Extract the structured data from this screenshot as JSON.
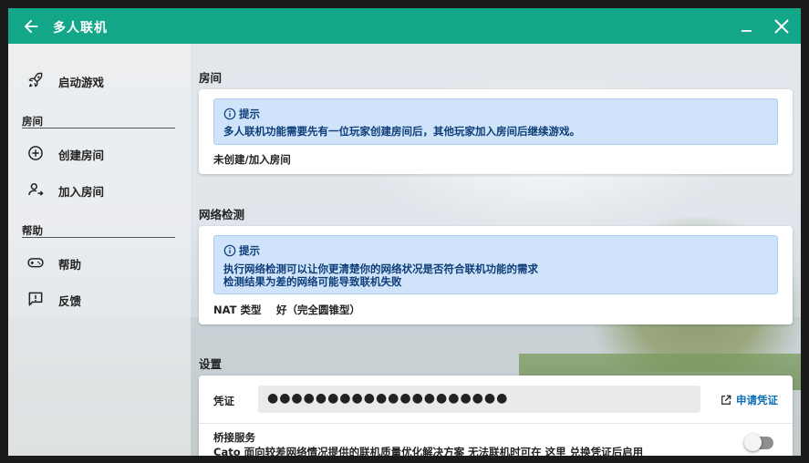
{
  "window": {
    "title": "多人联机"
  },
  "sidebar": {
    "top_item": {
      "label": "启动游戏",
      "icon": "rocket-icon"
    },
    "sections": [
      {
        "title": "房间",
        "items": [
          {
            "label": "创建房间",
            "icon": "add-circle-icon"
          },
          {
            "label": "加入房间",
            "icon": "join-user-icon"
          }
        ]
      },
      {
        "title": "帮助",
        "items": [
          {
            "label": "帮助",
            "icon": "gamepad-icon"
          },
          {
            "label": "反馈",
            "icon": "feedback-icon"
          }
        ]
      }
    ]
  },
  "room": {
    "title": "房间",
    "hint_title": "提示",
    "hint_text": "多人联机功能需要先有一位玩家创建房间后，其他玩家加入房间后继续游戏。",
    "status": "未创建/加入房间"
  },
  "network": {
    "title": "网络检测",
    "hint_title": "提示",
    "hint_line1": "执行网络检测可以让你更清楚你的网络状况是否符合联机功能的需求",
    "hint_line2": "检测结果为差的网络可能导致联机失败",
    "nat_label": "NAT 类型",
    "nat_value": "好（完全圆锥型）"
  },
  "settings": {
    "title": "设置",
    "credential_label": "凭证",
    "credential_value": "●●●●●●●●●●●●●●●●●●●●",
    "apply_label": "申请凭证",
    "bridge_title": "桥接服务",
    "bridge_desc": "Cato 面向较差网络情况提供的联机质量优化解决方案  无法联机时可在 这里 兑换凭证后启用",
    "bridge_enabled": false
  },
  "colors": {
    "titlebar": "#13a688",
    "hint_bg": "#cfe4fb",
    "hint_text": "#0e3d78",
    "link": "#0b6fb8"
  }
}
